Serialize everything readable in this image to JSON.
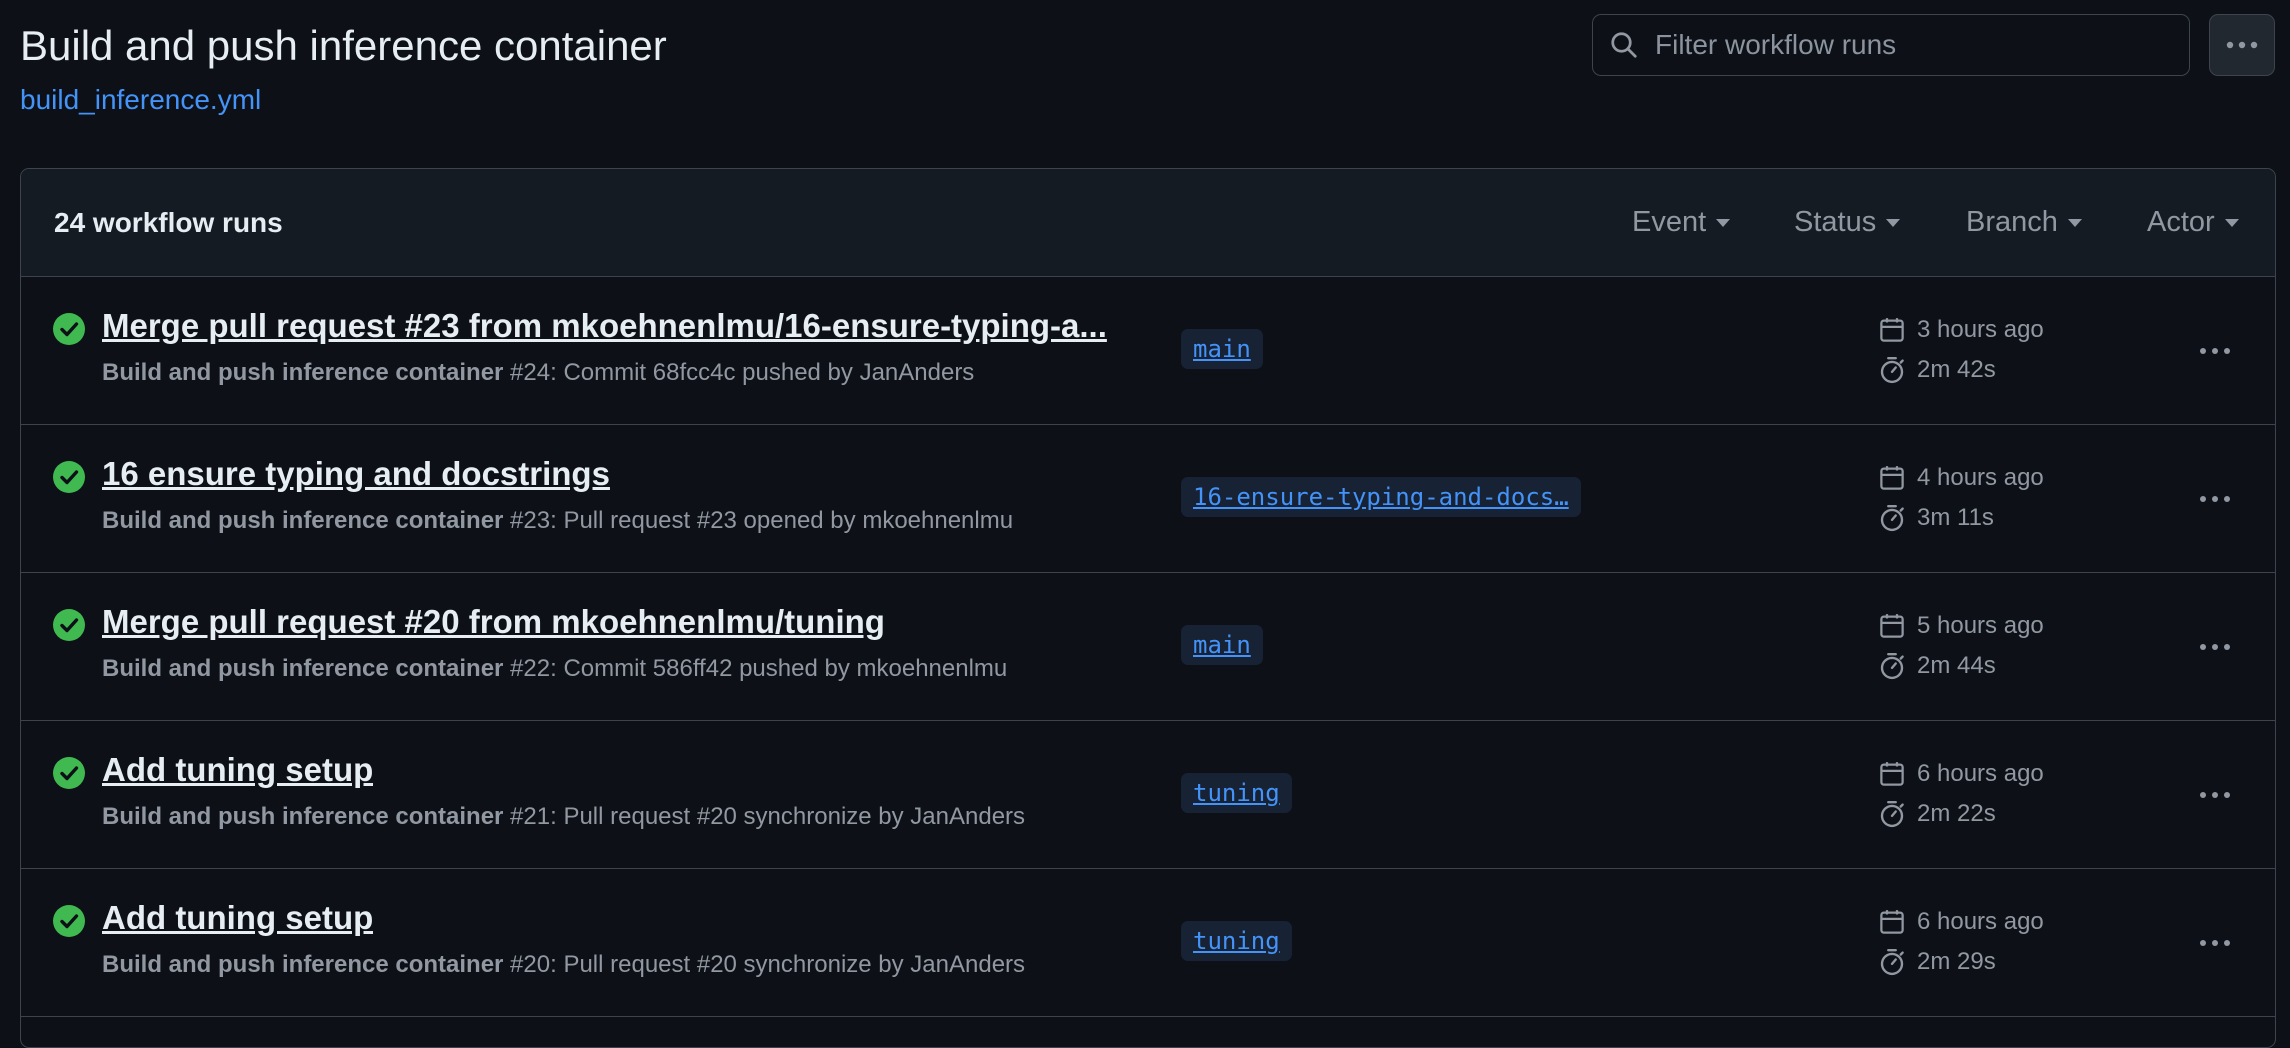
{
  "header": {
    "title": "Build and push inference container",
    "workflow_file": "build_inference.yml",
    "search_placeholder": "Filter workflow runs"
  },
  "runs_box": {
    "count_label": "24 workflow runs",
    "filters": [
      "Event",
      "Status",
      "Branch",
      "Actor"
    ]
  },
  "runs": [
    {
      "title": "Merge pull request #23 from mkoehnenlmu/16-ensure-typing-a...",
      "workflow": "Build and push inference container",
      "detail": " #24: Commit 68fcc4c pushed by JanAnders",
      "branch": "main",
      "when": "3 hours ago",
      "duration": "2m 42s",
      "status": "success"
    },
    {
      "title": "16 ensure typing and docstrings",
      "workflow": "Build and push inference container",
      "detail": " #23: Pull request #23 opened by mkoehnenlmu",
      "branch": "16-ensure-typing-and-docs…",
      "when": "4 hours ago",
      "duration": "3m 11s",
      "status": "success"
    },
    {
      "title": "Merge pull request #20 from mkoehnenlmu/tuning",
      "workflow": "Build and push inference container",
      "detail": " #22: Commit 586ff42 pushed by mkoehnenlmu",
      "branch": "main",
      "when": "5 hours ago",
      "duration": "2m 44s",
      "status": "success"
    },
    {
      "title": "Add tuning setup",
      "workflow": "Build and push inference container",
      "detail": " #21: Pull request #20 synchronize by JanAnders",
      "branch": "tuning",
      "when": "6 hours ago",
      "duration": "2m 22s",
      "status": "success"
    },
    {
      "title": "Add tuning setup",
      "workflow": "Build and push inference container",
      "detail": " #20: Pull request #20 synchronize by JanAnders",
      "branch": "tuning",
      "when": "6 hours ago",
      "duration": "2m 29s",
      "status": "success"
    }
  ],
  "icons": {
    "status": "check-circle-icon",
    "calendar": "calendar-icon",
    "duration": "stopwatch-icon",
    "menu": "kebab-horizontal-icon",
    "search": "search-icon"
  },
  "colors": {
    "background": "#0d1117",
    "link": "#4493f8",
    "success": "#3fb950",
    "muted": "#9198a1",
    "border": "#3d444d"
  }
}
